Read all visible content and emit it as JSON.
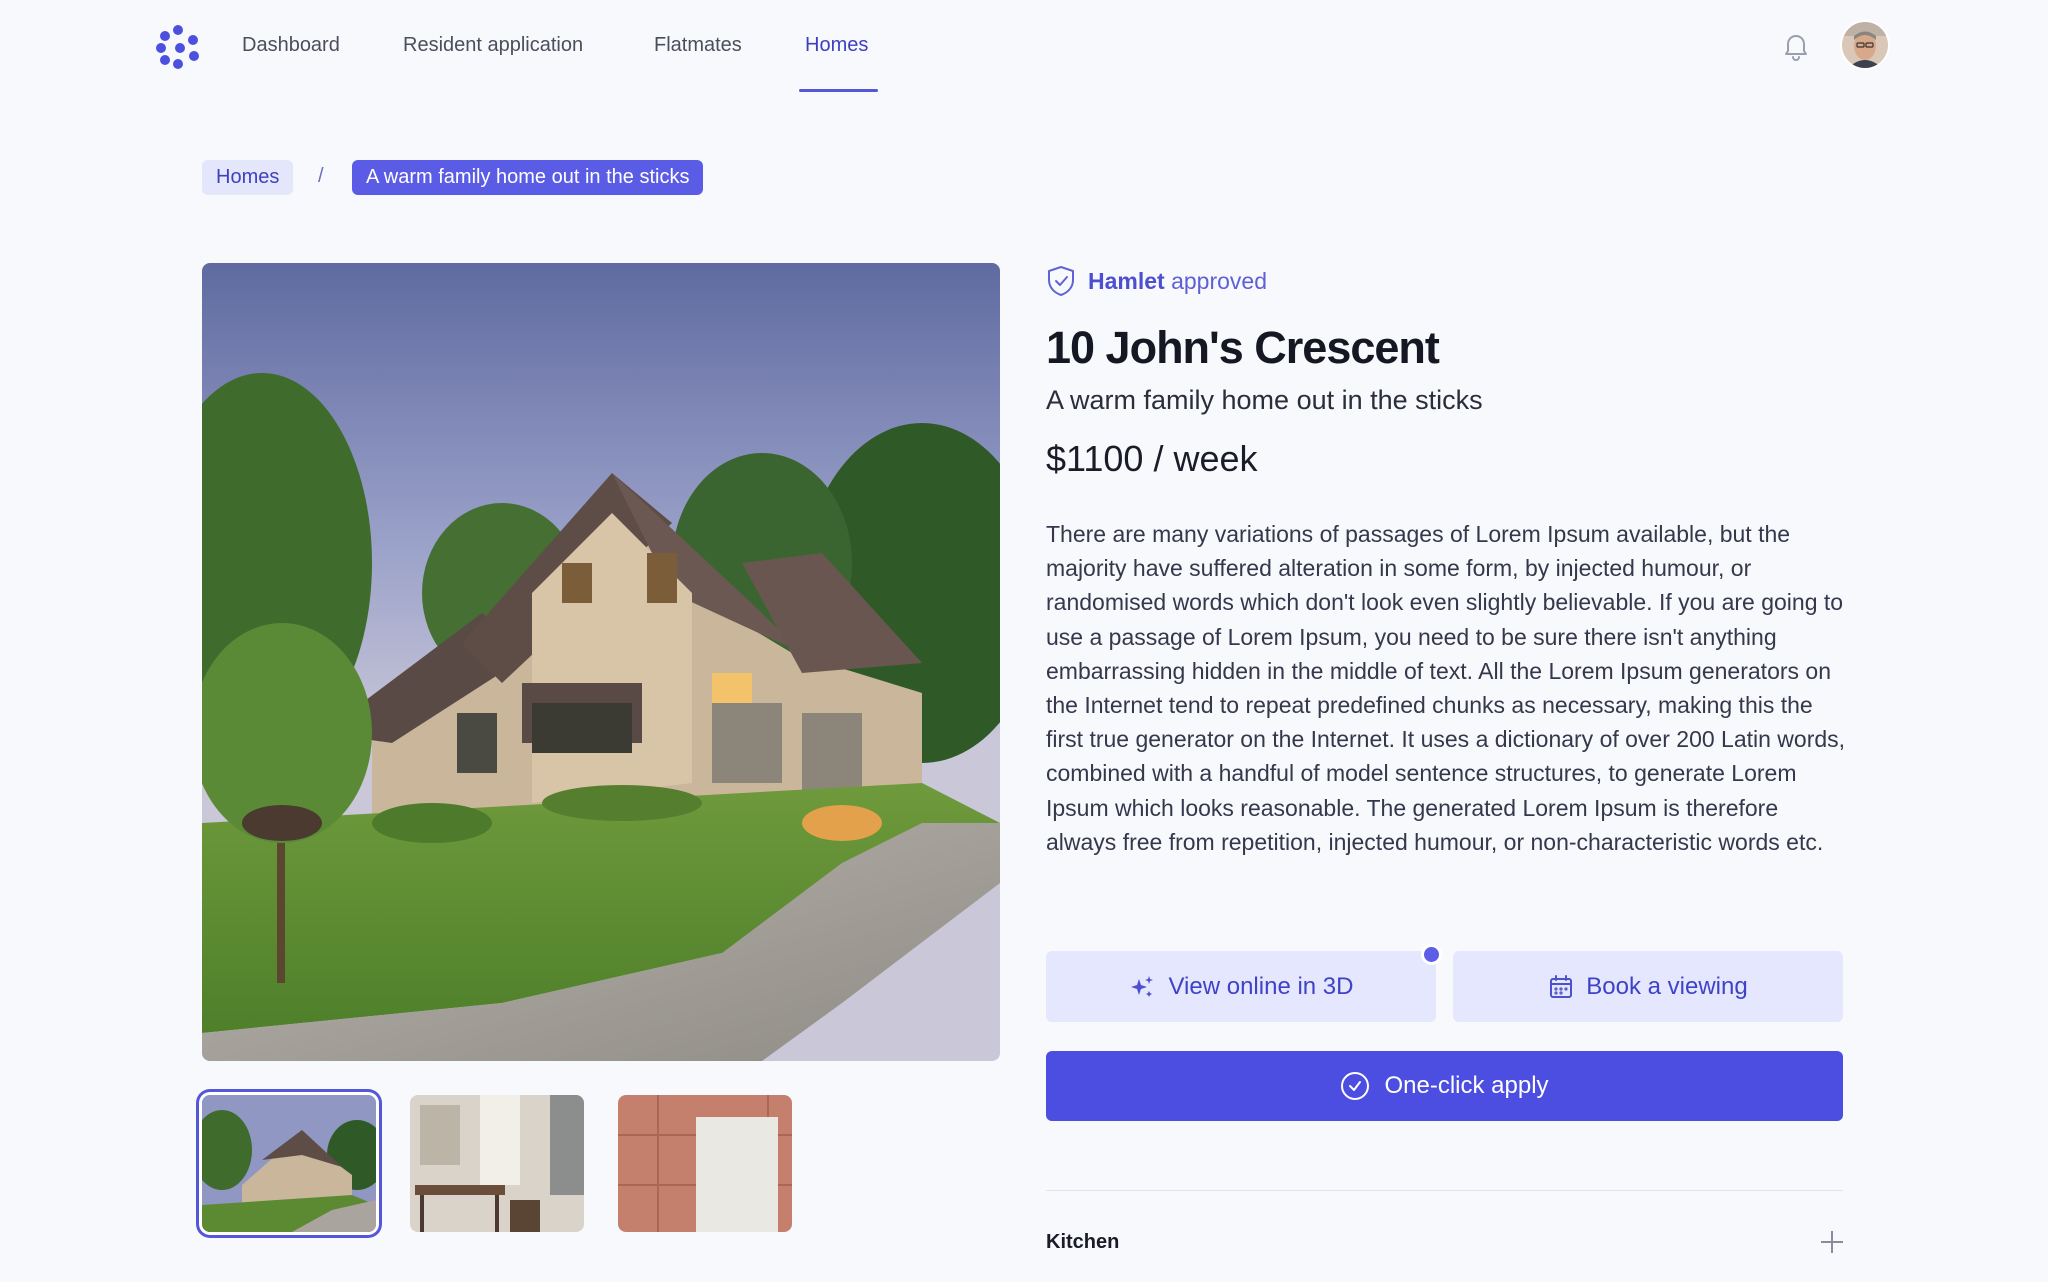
{
  "nav": {
    "logo_icon": "brand-molecule-icon",
    "links": [
      {
        "label": "Dashboard"
      },
      {
        "label": "Resident application"
      },
      {
        "label": "Flatmates"
      },
      {
        "label": "Homes",
        "active": true
      }
    ],
    "notification_icon": "bell-icon"
  },
  "breadcrumb": {
    "home": "Homes",
    "separator": "/",
    "current": "A warm family home out in the sticks"
  },
  "listing": {
    "badge_brand": "Hamlet",
    "badge_text": "approved",
    "title": "10 John's Crescent",
    "subtitle": "A warm family home out in the sticks",
    "price": "$1100 / week",
    "description": "There are many variations of passages of Lorem Ipsum available, but the majority have suffered alteration in some form, by injected humour, or randomised words which don't look even slightly believable. If you are going to use a passage of Lorem Ipsum, you need to be sure there isn't anything embarrassing hidden in the middle of text. All the Lorem Ipsum generators on the Internet tend to repeat predefined chunks as necessary, making this the first true generator on the Internet. It uses a dictionary of over 200 Latin words, combined with a handful of model sentence structures, to generate Lorem Ipsum which looks reasonable. The generated Lorem Ipsum is therefore always free from repetition, injected humour, or non-characteristic words etc."
  },
  "actions": {
    "view_3d": "View online in 3D",
    "book_viewing": "Book a viewing",
    "apply": "One-click apply"
  },
  "sections": [
    {
      "label": "Kitchen"
    }
  ],
  "colors": {
    "accent": "#4b4ee0",
    "accent_soft": "#e4e7fd",
    "background": "#f8f9fd"
  }
}
